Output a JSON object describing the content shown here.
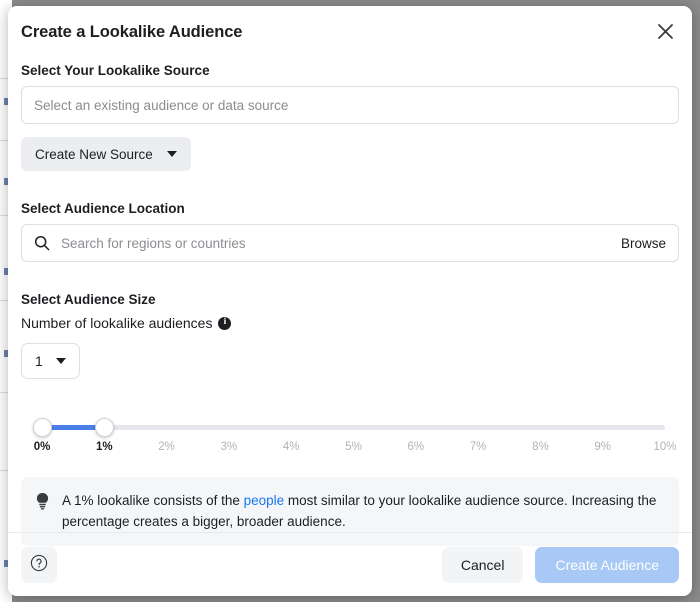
{
  "modal": {
    "title": "Create a Lookalike Audience",
    "close_icon": "close-icon"
  },
  "source_section": {
    "label": "Select Your Lookalike Source",
    "input_placeholder": "Select an existing audience or data source",
    "input_value": "",
    "create_button_label": "Create New Source"
  },
  "location_section": {
    "label": "Select Audience Location",
    "search_placeholder": "Search for regions or countries",
    "search_value": "",
    "browse_label": "Browse"
  },
  "size_section": {
    "label": "Select Audience Size",
    "count_label": "Number of lookalike audiences",
    "count_value": "1",
    "info_glyph": "i"
  },
  "slider": {
    "min_label": "0%",
    "max_label": "10%",
    "range_start": 0,
    "range_end": 1,
    "fill_color": "#4a7fe8",
    "track_color": "#e4e6eb",
    "ticks": [
      {
        "label": "0%",
        "value": 0,
        "active": true
      },
      {
        "label": "1%",
        "value": 1,
        "active": true
      },
      {
        "label": "2%",
        "value": 2,
        "active": false
      },
      {
        "label": "3%",
        "value": 3,
        "active": false
      },
      {
        "label": "4%",
        "value": 4,
        "active": false
      },
      {
        "label": "5%",
        "value": 5,
        "active": false
      },
      {
        "label": "6%",
        "value": 6,
        "active": false
      },
      {
        "label": "7%",
        "value": 7,
        "active": false
      },
      {
        "label": "8%",
        "value": 8,
        "active": false
      },
      {
        "label": "9%",
        "value": 9,
        "active": false
      },
      {
        "label": "10%",
        "value": 10,
        "active": false
      }
    ]
  },
  "tip": {
    "icon": "lightbulb-icon",
    "text_before": "A 1% lookalike consists of the ",
    "link_text": "people",
    "text_after": " most similar to your lookalike audience source. Increasing the percentage creates a bigger, broader audience."
  },
  "footer": {
    "help_glyph": "?",
    "cancel_label": "Cancel",
    "submit_label": "Create Audience",
    "submit_color": "#a8c8f5"
  }
}
